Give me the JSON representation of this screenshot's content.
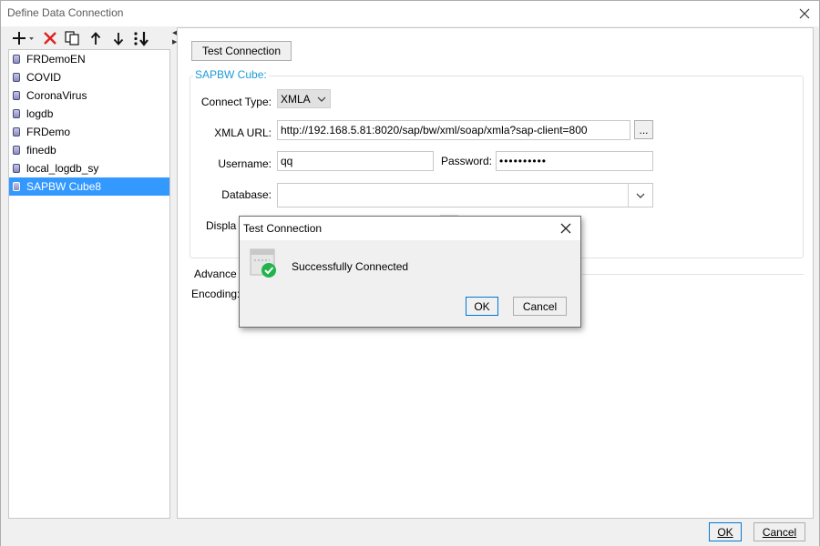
{
  "window": {
    "title": "Define Data Connection"
  },
  "toolbar": {
    "add_icon": "plus-dropdown-icon",
    "delete_icon": "red-x-icon",
    "copy_icon": "copy-icon",
    "up_icon": "arrow-up-icon",
    "down_icon": "arrow-down-icon",
    "sort_icon": "sort-icon"
  },
  "connections": [
    {
      "label": "FRDemoEN"
    },
    {
      "label": "COVID"
    },
    {
      "label": "CoronaVirus"
    },
    {
      "label": "logdb"
    },
    {
      "label": "FRDemo"
    },
    {
      "label": "finedb"
    },
    {
      "label": "local_logdb_sy"
    },
    {
      "label": "SAPBW Cube8",
      "selected": true
    }
  ],
  "main": {
    "test_connection_label": "Test Connection",
    "section_title": "SAPBW Cube:",
    "connect_type_label": "Connect Type:",
    "connect_type_value": "XMLA",
    "xmla_url_label": "XMLA URL:",
    "xmla_url_value": "http://192.168.5.81:8020/sap/bw/xml/soap/xmla?sap-client=800",
    "browse_label": "...",
    "username_label": "Username:",
    "username_value": "qq",
    "password_label": "Password:",
    "password_value": "••••••••••",
    "database_label": "Database:",
    "database_value": "",
    "display_label": "Displa",
    "advanced_label": "Advance",
    "encoding_label": "Encoding:"
  },
  "footer": {
    "ok_label": "OK",
    "cancel_label": "Cancel"
  },
  "dialog": {
    "title": "Test Connection",
    "message": "Successfully Connected",
    "ok_label": "OK",
    "cancel_label": "Cancel"
  },
  "colors": {
    "accent": "#1e9bd8",
    "selection": "#3399ff",
    "success": "#22b34b",
    "delete": "#e02020"
  }
}
